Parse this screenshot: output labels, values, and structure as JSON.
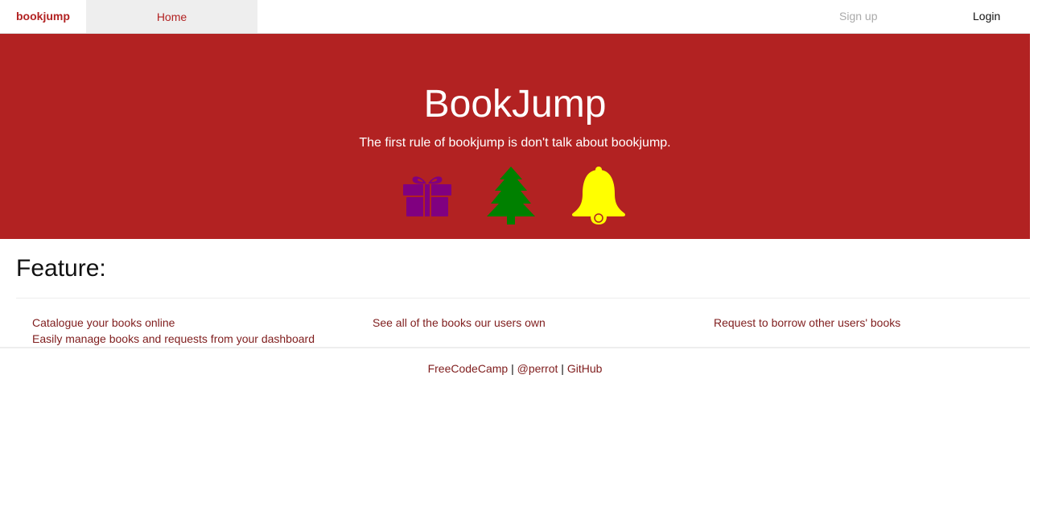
{
  "nav": {
    "brand": "bookjump",
    "home": "Home",
    "signup": "Sign up",
    "login": "Login"
  },
  "hero": {
    "title": "BookJump",
    "subtitle": "The first rule of bookjump is don't talk about bookjump.",
    "icons": [
      {
        "name": "gift-icon",
        "color": "#800080"
      },
      {
        "name": "tree-icon",
        "color": "#008000"
      },
      {
        "name": "bell-icon",
        "color": "#ffff00"
      }
    ]
  },
  "features": {
    "heading": "Feature:",
    "items": [
      "Catalogue your books online",
      "See all of the books our users own",
      "Request to borrow other users' books",
      "Easily manage books and requests from your dashboard"
    ]
  },
  "footer": {
    "link1": "FreeCodeCamp",
    "sep": "|",
    "link2": "@perrot",
    "link3": "GitHub"
  },
  "colors": {
    "brand": "#b22222",
    "link": "#7f1d1d",
    "hero_bg": "#b22222"
  }
}
